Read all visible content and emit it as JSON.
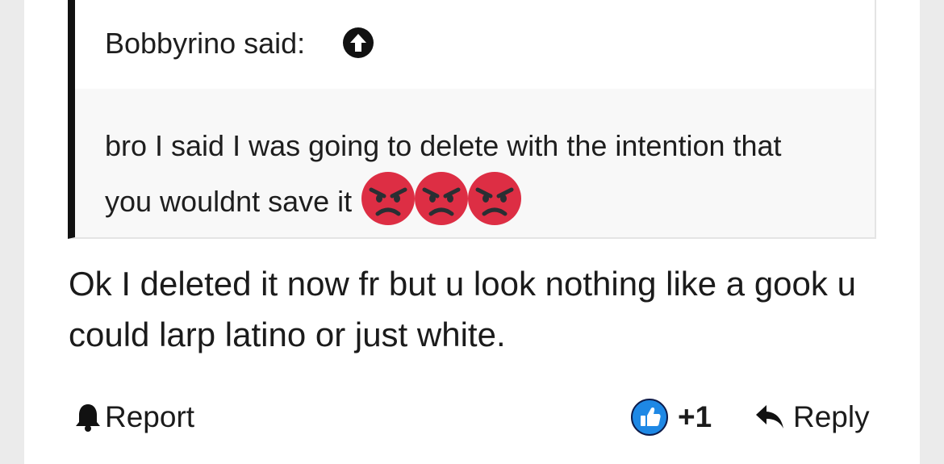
{
  "quote": {
    "author_label": "Bobbyrino said:",
    "text": "bro I said I was going to delete with the intention that you wouldnt save it",
    "emojis": [
      "angry-face-emoji",
      "angry-face-emoji",
      "angry-face-emoji"
    ],
    "jump_icon": "arrow-up-circle-icon"
  },
  "message": {
    "text": "Ok I deleted it now fr but u look nothing like a gook u could larp latino or just white."
  },
  "actions": {
    "report_label": "Report",
    "report_icon": "bell-icon",
    "like_icon": "thumbs-up-icon",
    "like_count": "+1",
    "reply_label": "Reply",
    "reply_icon": "reply-arrow-icon"
  },
  "colors": {
    "quote_border": "#111111",
    "quote_body_bg": "#f8f8f8",
    "emoji_red": "#dd2e44",
    "like_blue": "#1e88e5",
    "page_bg": "#ebebeb"
  }
}
